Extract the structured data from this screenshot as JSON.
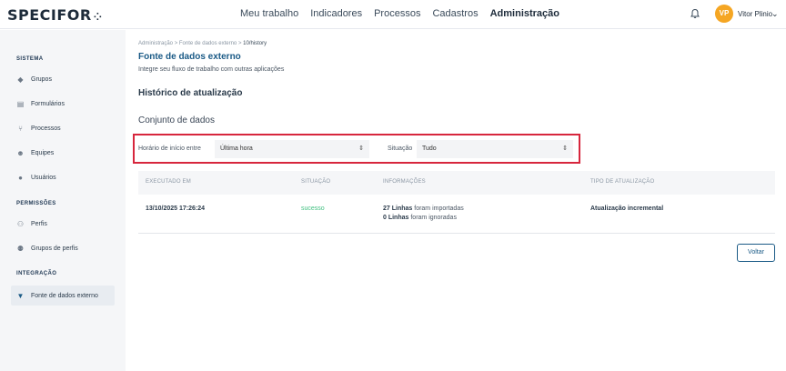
{
  "brand": {
    "name": "SPECIFOR",
    "mark": "⁘"
  },
  "nav": {
    "items": [
      "Meu trabalho",
      "Indicadores",
      "Processos",
      "Cadastros",
      "Administração"
    ],
    "active": "Administração"
  },
  "user": {
    "initials": "VP",
    "name": "Vitor Plinio",
    "avatar_color": "#f5a623"
  },
  "sidebar": {
    "sections": [
      {
        "title": "SISTEMA",
        "items": [
          {
            "label": "Grupos",
            "icon": "tag-icon"
          },
          {
            "label": "Formulários",
            "icon": "document-icon"
          },
          {
            "label": "Processos",
            "icon": "flow-icon"
          },
          {
            "label": "Equipes",
            "icon": "team-icon"
          },
          {
            "label": "Usuários",
            "icon": "user-icon"
          }
        ]
      },
      {
        "title": "PERMISSÕES",
        "items": [
          {
            "label": "Perfis",
            "icon": "profile-icon"
          },
          {
            "label": "Grupos de perfis",
            "icon": "profile-group-icon"
          }
        ]
      },
      {
        "title": "INTEGRAÇÃO",
        "items": [
          {
            "label": "Fonte de dados externo",
            "icon": "funnel-icon",
            "active": true
          }
        ]
      }
    ]
  },
  "breadcrumb": {
    "parts": [
      "Administração",
      "Fonte de dados externo"
    ],
    "current": "10/history",
    "separator": ">"
  },
  "page": {
    "title": "Fonte de dados externo",
    "subtitle": "Integre seu fluxo de trabalho com outras aplicações",
    "history_title": "Histórico de atualização",
    "dataset_title": "Conjunto de dados"
  },
  "filters": {
    "start_label": "Horário de início entre",
    "start_value": "Última hora",
    "status_label": "Situação",
    "status_value": "Tudo",
    "highlight_color": "#d7263d"
  },
  "table": {
    "headers": [
      "EXECUTADO EM",
      "SITUAÇÃO",
      "INFORMAÇÕES",
      "TIPO DE ATUALIZAÇÃO"
    ],
    "rows": [
      {
        "executed_at": "13/10/2025 17:26:24",
        "status": "sucesso",
        "status_color": "#3fbf7f",
        "imported_count": "27 Linhas",
        "imported_text": "foram importadas",
        "ignored_count": "0 Linhas",
        "ignored_text": "foram ignoradas",
        "update_type": "Atualização incremental"
      }
    ]
  },
  "actions": {
    "back_label": "Voltar"
  },
  "colors": {
    "accent": "#1a5a86",
    "sidebar_bg": "#f5f6f8"
  }
}
